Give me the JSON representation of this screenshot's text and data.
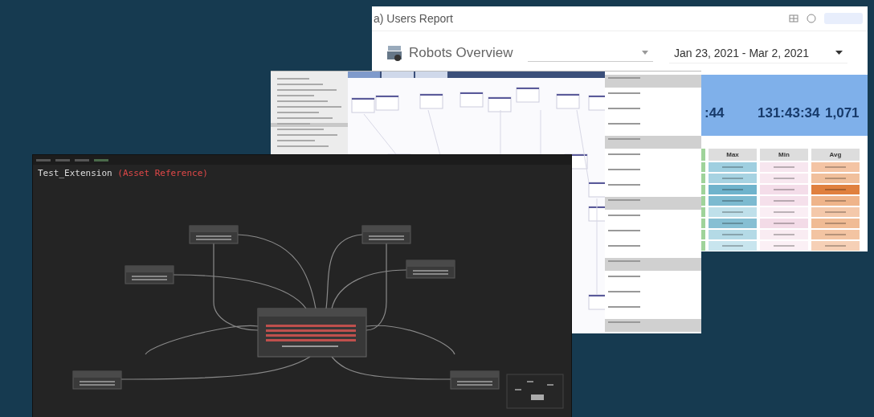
{
  "report_window": {
    "title": "a) Users Report",
    "page_title": "Robots Overview",
    "date_range": "Jan 23, 2021 - Mar 2, 2021",
    "kpis": [
      {
        "value": ":44"
      },
      {
        "value": "131:43:34"
      },
      {
        "value": "1,071"
      }
    ],
    "table": {
      "columns": [
        "Max",
        "Min",
        "Avg"
      ]
    }
  },
  "editor_window": {
    "tabs": [
      {
        "selected": true
      },
      {
        "selected": false
      },
      {
        "selected": false
      }
    ]
  },
  "graph_window": {
    "title": "Test_Extension",
    "title_suffix": "(Asset Reference)"
  }
}
